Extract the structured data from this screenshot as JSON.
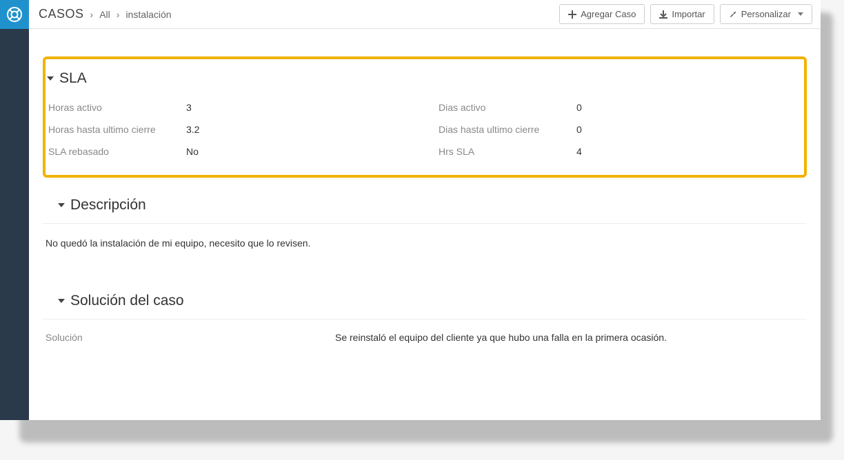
{
  "header": {
    "module": "CASOS",
    "crumb_all": "All",
    "crumb_current": "instalación",
    "btn_add": "Agregar Caso",
    "btn_import": "Importar",
    "btn_customize": "Personalizar"
  },
  "sections": {
    "sla": {
      "title": "SLA",
      "fields": {
        "horas_activo_label": "Horas activo",
        "horas_activo_value": "3",
        "dias_activo_label": "Dias activo",
        "dias_activo_value": "0",
        "horas_cierre_label": "Horas hasta ultimo cierre",
        "horas_cierre_value": "3.2",
        "dias_cierre_label": "Dias hasta ultimo cierre",
        "dias_cierre_value": "0",
        "sla_rebasado_label": "SLA rebasado",
        "sla_rebasado_value": "No",
        "hrs_sla_label": "Hrs SLA",
        "hrs_sla_value": "4"
      }
    },
    "descripcion": {
      "title": "Descripción",
      "body": "No quedó la instalación de mi equipo, necesito que lo revisen."
    },
    "solucion": {
      "title": "Solución del caso",
      "label": "Solución",
      "value": "Se reinstaló el equipo del cliente ya que hubo una falla en la primera ocasión."
    }
  },
  "colors": {
    "highlight_border": "#f2b200",
    "sidebar_bg": "#2b3a4a",
    "sidebar_active": "#1f92cd"
  }
}
